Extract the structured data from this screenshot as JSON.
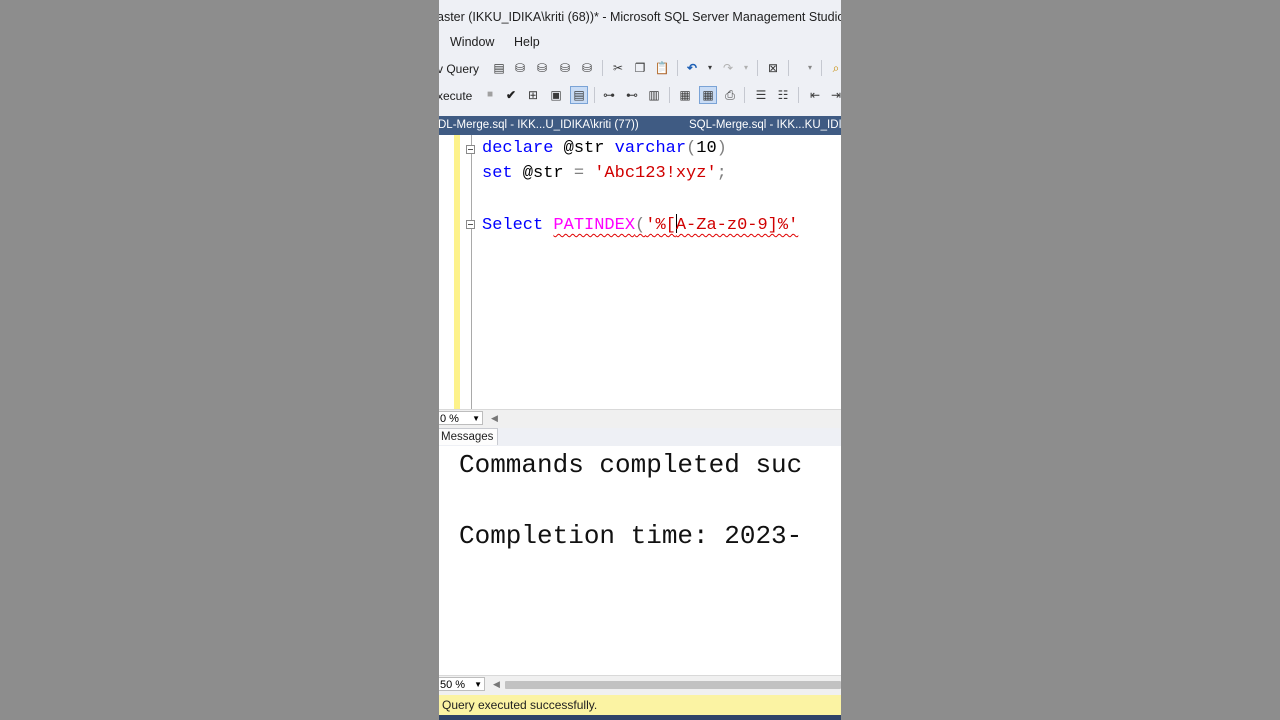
{
  "window": {
    "title": "aster (IKKU_IDIKA\\kriti (68))* - Microsoft SQL Server Management Studio"
  },
  "menu": {
    "items": [
      "Window",
      "Help"
    ]
  },
  "toolbar": {
    "new_query": "v Query",
    "execute": "xecute",
    "icons": [
      "mdx-query-icon",
      "dmx-query-icon",
      "xmla-query-icon",
      "dax-query-icon",
      "cut-icon",
      "copy-icon",
      "paste-icon",
      "undo-icon",
      "redo-icon",
      "properties-icon",
      "search-icon"
    ]
  },
  "tabs": [
    {
      "label": "DL-Merge.sql - IKK...U_IDIKA\\kriti (77))"
    },
    {
      "label": "SQL-Merge.sql - IKK...KU_IDIK"
    }
  ],
  "editor": {
    "line1": {
      "kw1": "declare",
      "var": " @str ",
      "kw2": "varchar",
      "paren_open": "(",
      "num": "10",
      "paren_close": ")"
    },
    "line2": {
      "kw": "set",
      "var": " @str ",
      "eq": "= ",
      "str": "'Abc123!xyz'",
      "semi": ";"
    },
    "line3": {
      "kw": "Select",
      "sp": " ",
      "fn": "PATINDEX",
      "paren": "(",
      "str_a": "'%[",
      "str_b": "A-Za-z0-9]%'"
    },
    "zoom": "0 %"
  },
  "results": {
    "tab_label": "Messages",
    "line1": "Commands completed suc",
    "line2": "Completion time: 2023-",
    "zoom": "50 %"
  },
  "status": {
    "text": "Query executed successfully.",
    "color": "#fbf3a3"
  },
  "colors": {
    "keyword": "#0000ff",
    "string": "#d00000",
    "function": "#ff00ff",
    "tab_bar": "#3f5b83"
  }
}
